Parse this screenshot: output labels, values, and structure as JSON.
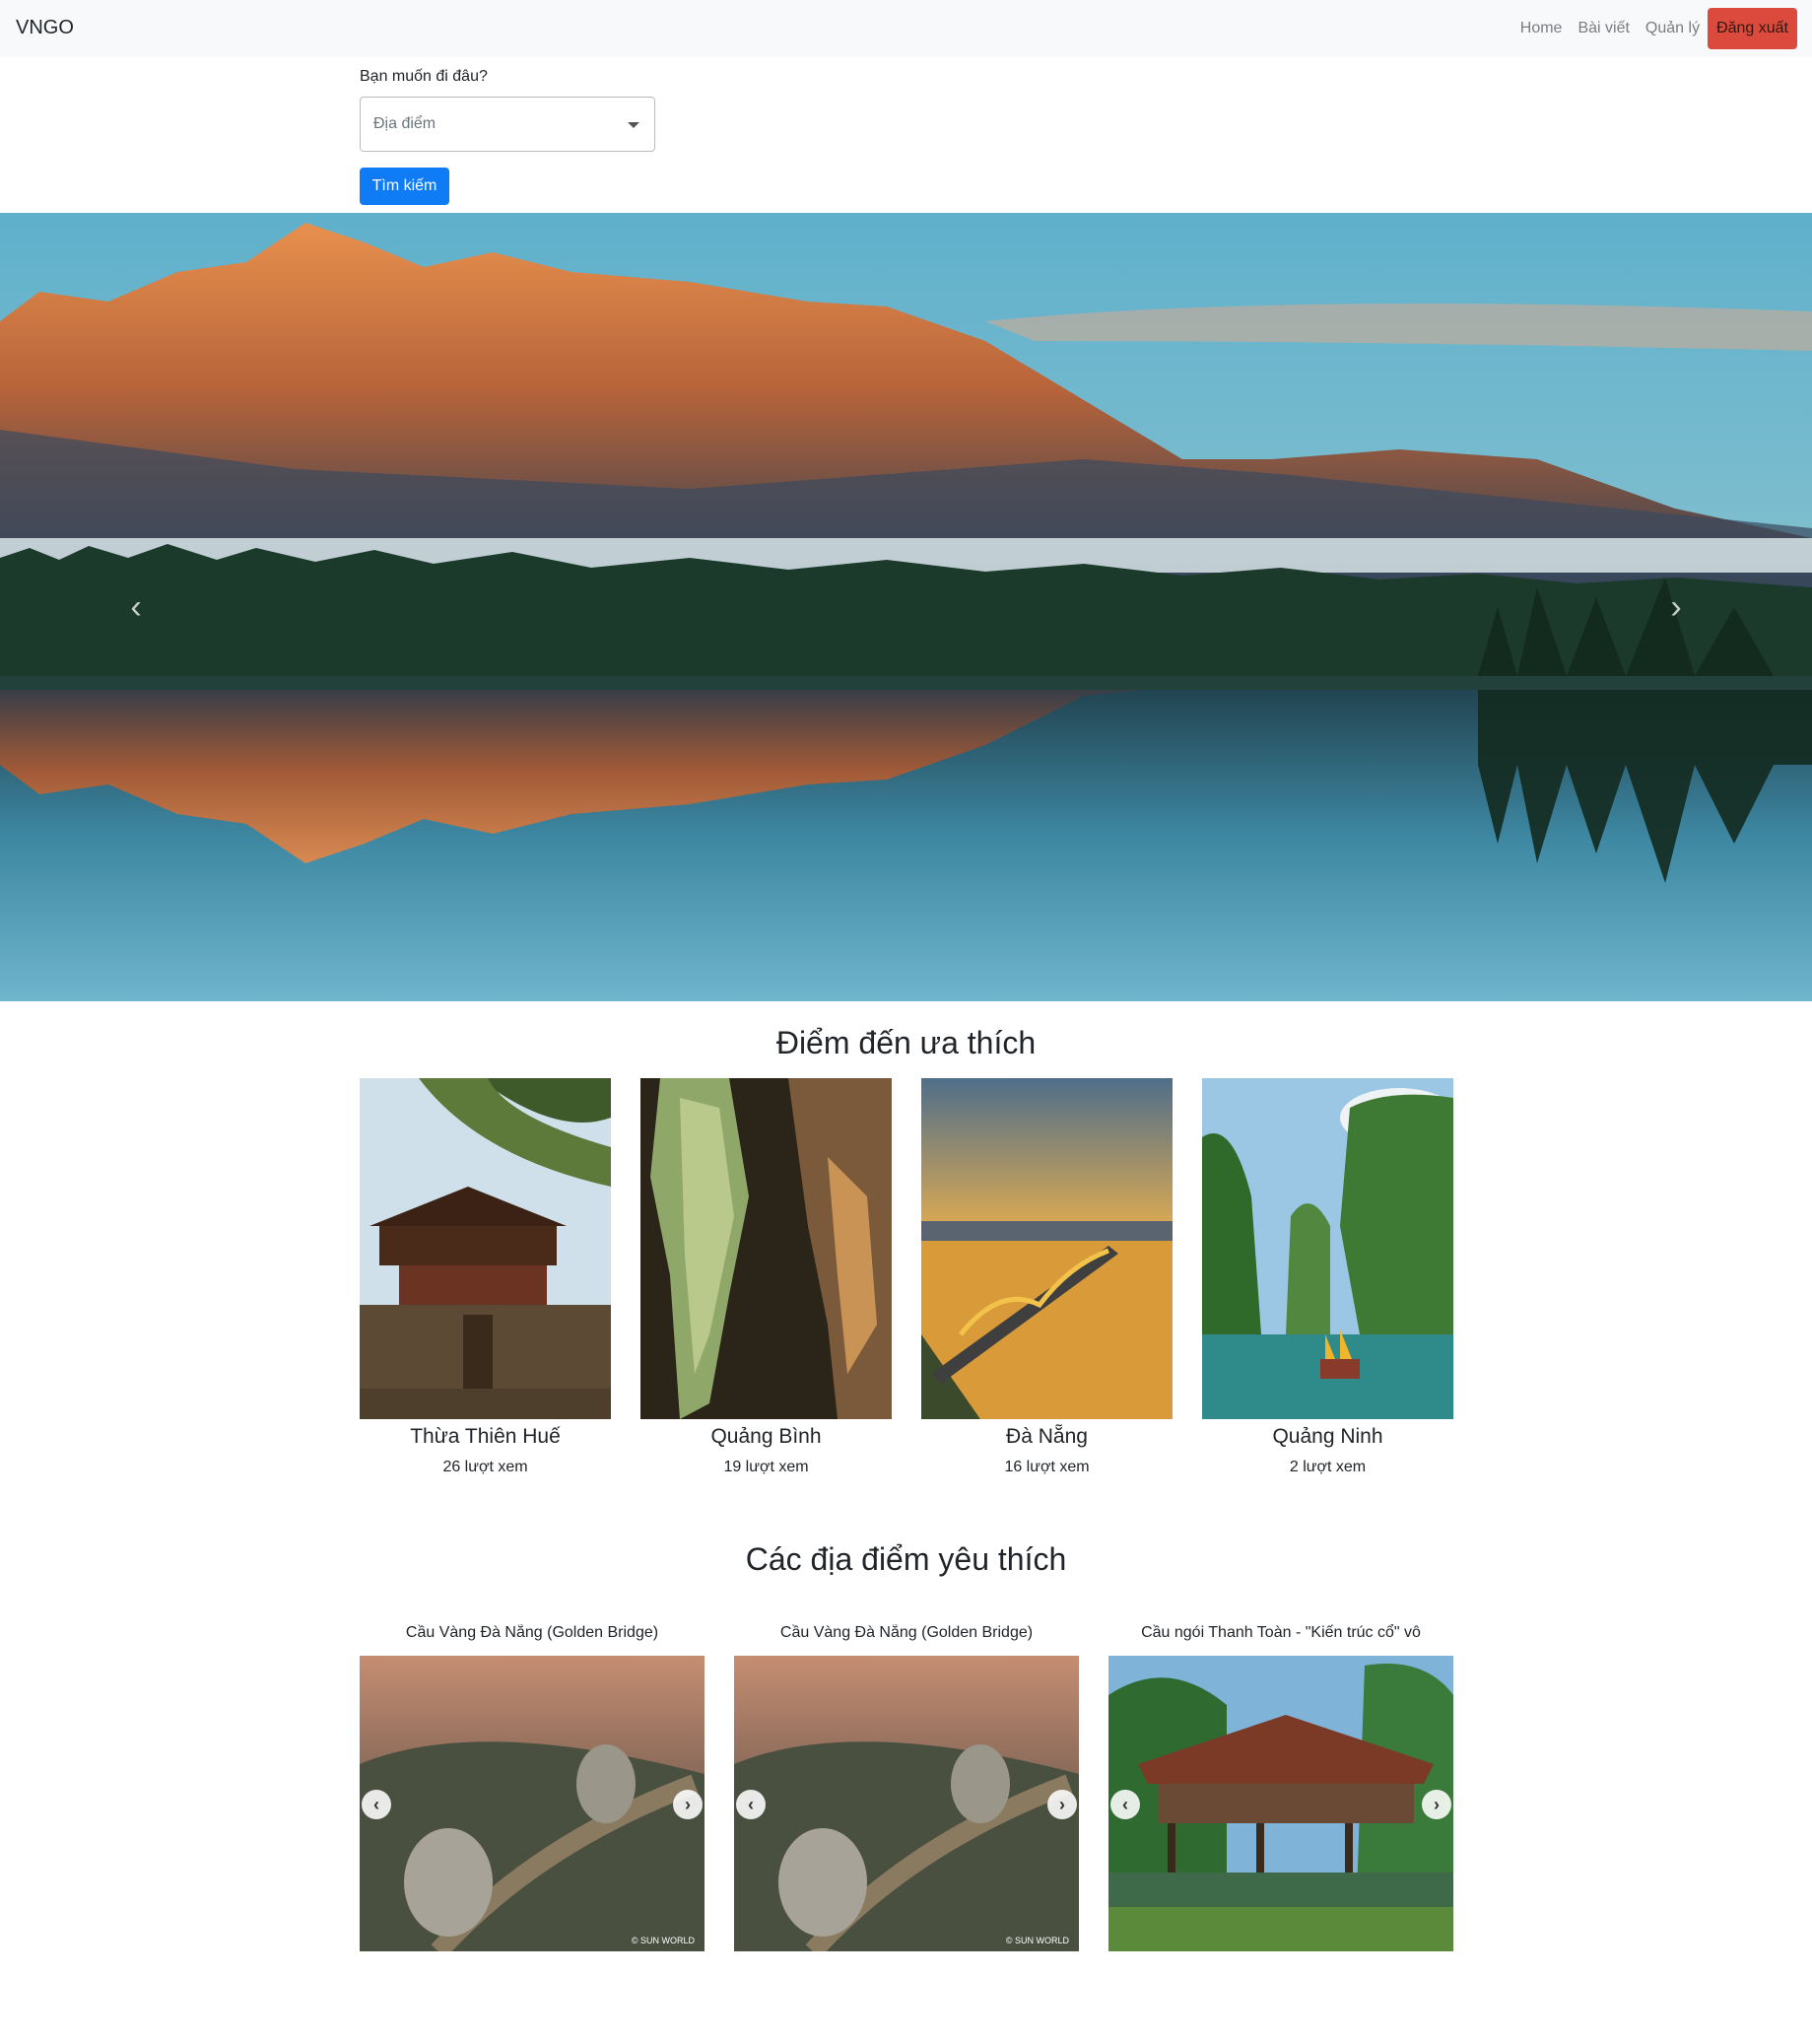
{
  "navbar": {
    "brand": "VNGO",
    "links": [
      "Home",
      "Bài viết",
      "Quản lý"
    ],
    "logout": "Đăng xuất"
  },
  "search": {
    "label": "Bạn muốn đi đâu?",
    "placeholder": "Địa điểm",
    "button": "Tìm kiếm"
  },
  "hero": {
    "prev_icon": "chevron-left-icon",
    "next_icon": "chevron-right-icon",
    "prev_glyph": "‹",
    "next_glyph": "›"
  },
  "favorites": {
    "title": "Điểm đến ưa thích",
    "items": [
      {
        "name": "Thừa Thiên Huế",
        "views": "26 lượt xem"
      },
      {
        "name": "Quảng Bình",
        "views": "19 lượt xem"
      },
      {
        "name": "Đà Nẵng",
        "views": "16 lượt xem"
      },
      {
        "name": "Quảng Ninh",
        "views": "2 lượt xem"
      }
    ]
  },
  "places": {
    "title": "Các địa điểm yêu thích",
    "items": [
      {
        "caption": "Cầu Vàng Đà Nẵng (Golden Bridge)",
        "watermark": "© SUN WORLD"
      },
      {
        "caption": "Cầu Vàng Đà Nẵng (Golden Bridge)",
        "watermark": "© SUN WORLD"
      },
      {
        "caption": "Cầu ngói Thanh Toàn - \"Kiến trúc cổ\" vô"
      }
    ],
    "prev_glyph": "‹",
    "next_glyph": "›"
  },
  "colors": {
    "primary": "#0f7cf6",
    "danger": "#dc4a3e",
    "navbar_bg": "#f8f9fa"
  }
}
